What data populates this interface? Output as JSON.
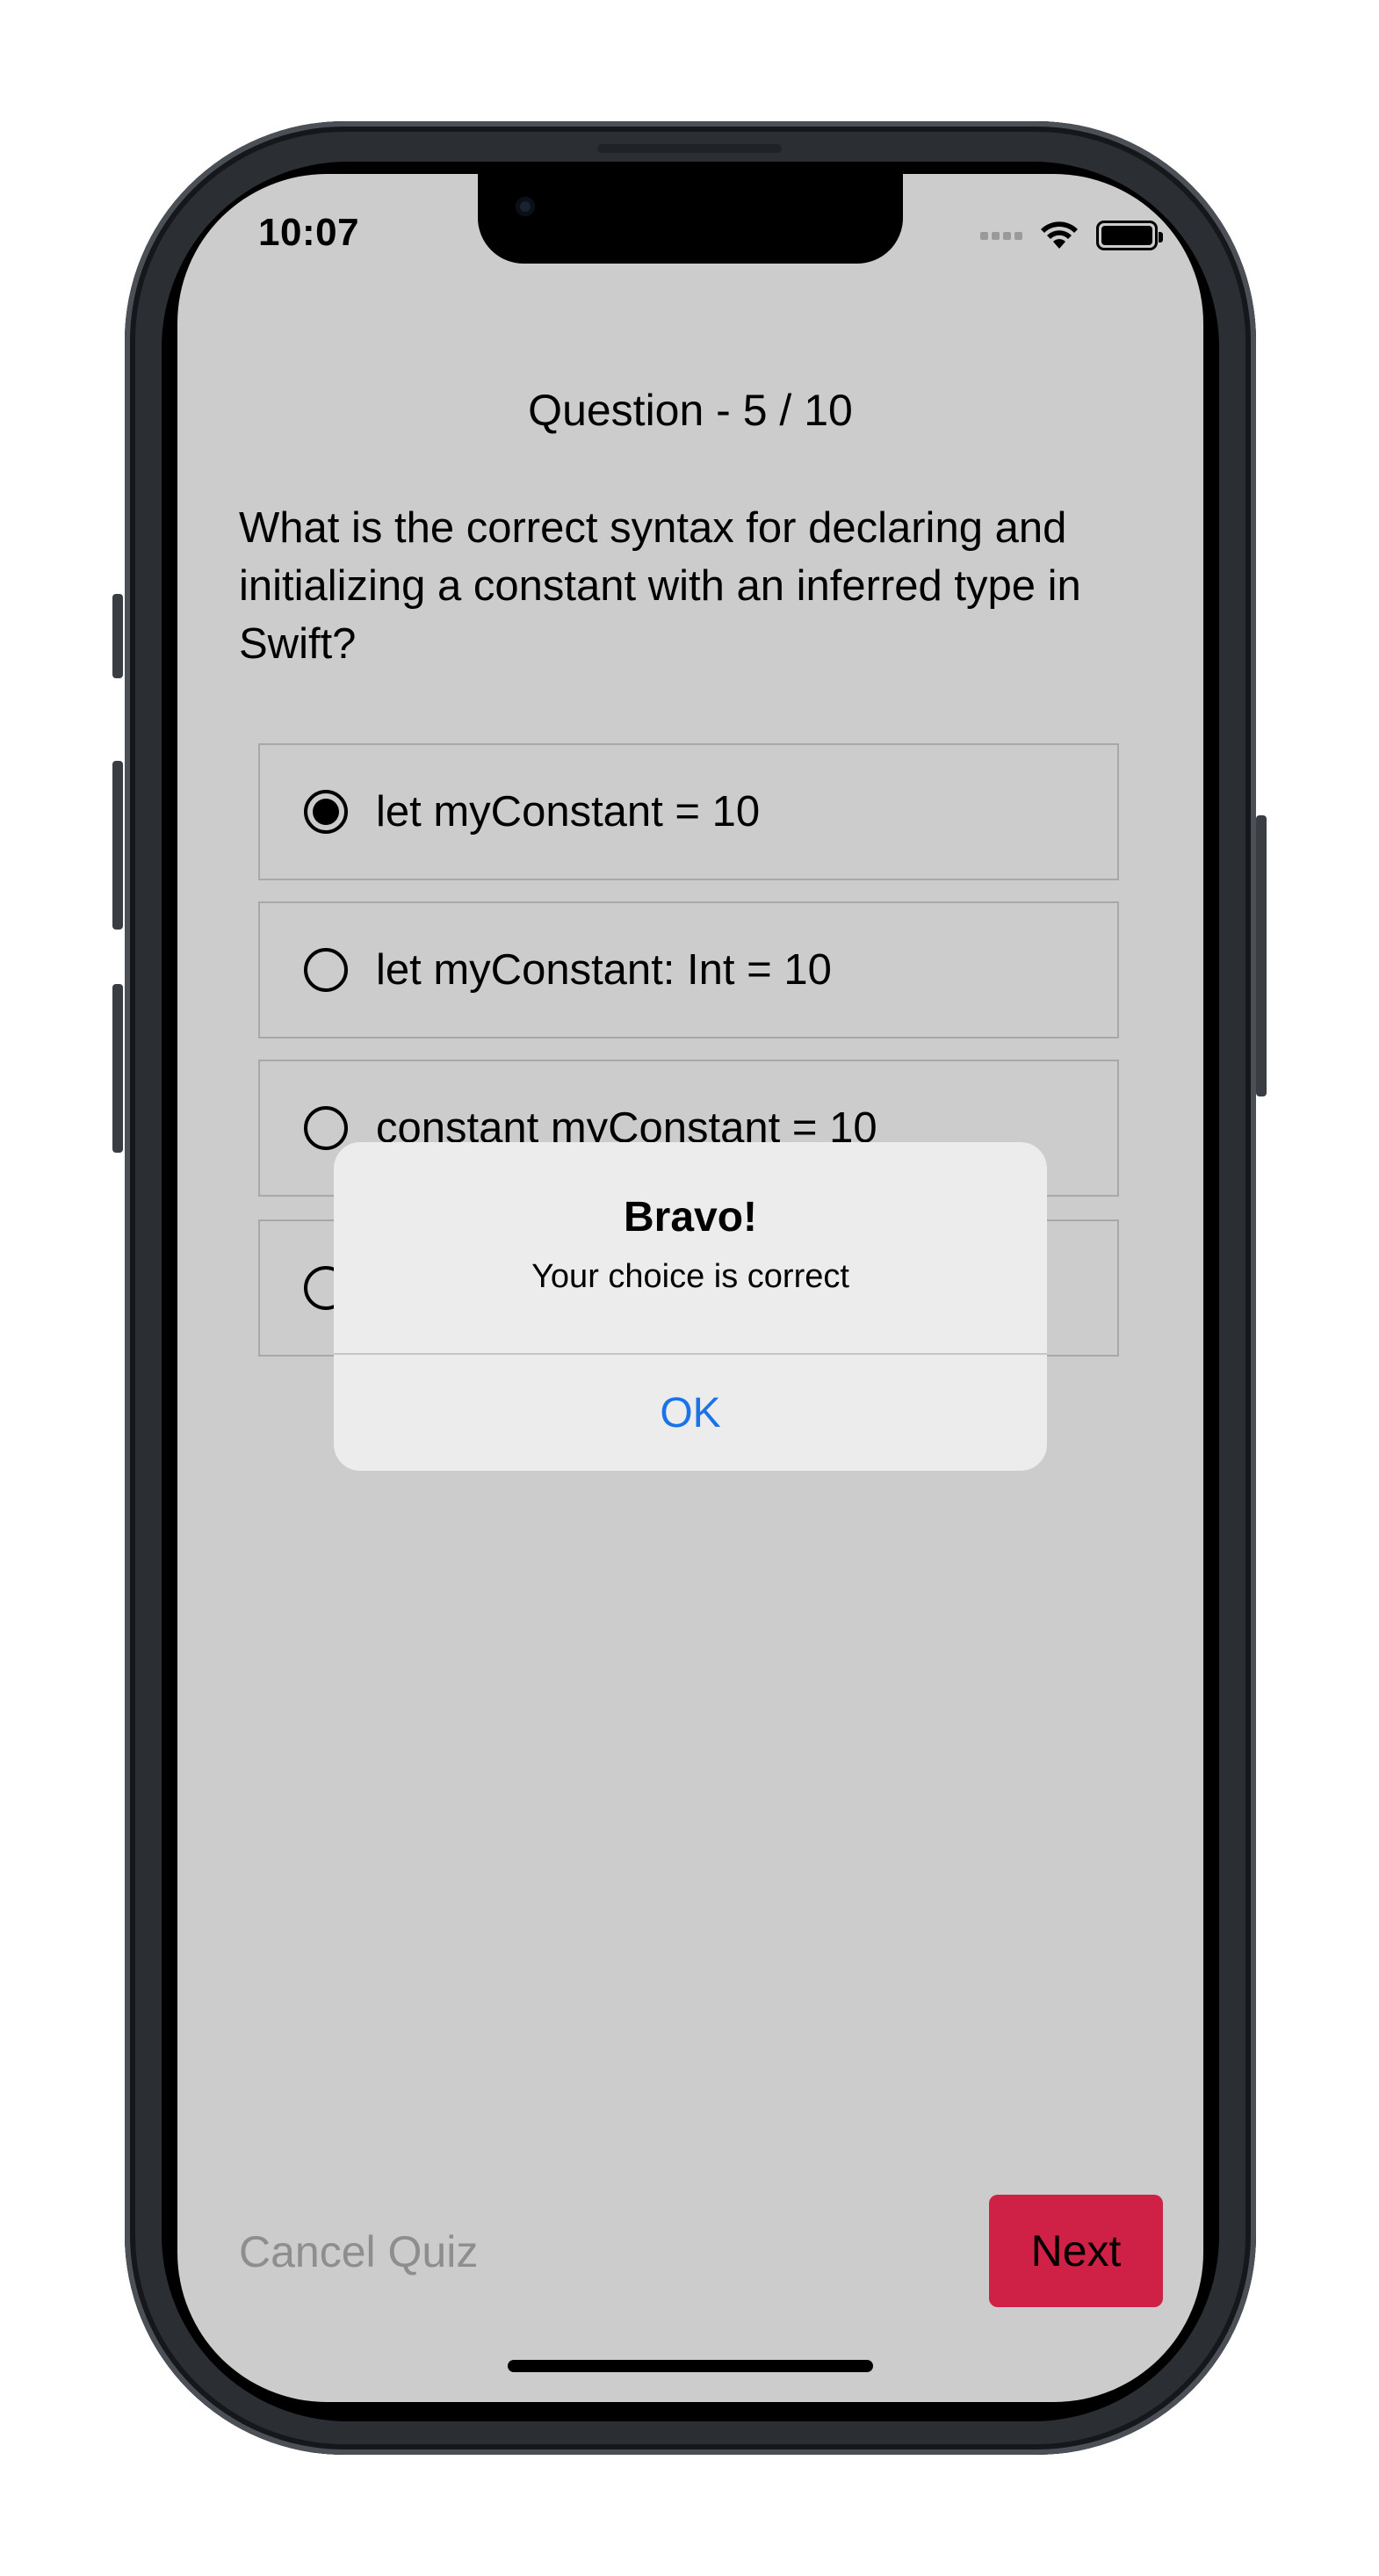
{
  "status_bar": {
    "time": "10:07",
    "icons": [
      "signal-dots-icon",
      "wifi-icon",
      "battery-icon"
    ]
  },
  "quiz": {
    "progress_label": "Question - 5 / 10",
    "question": "What is the correct syntax for declaring and initializing a constant with an inferred type in Swift?",
    "options": [
      {
        "label": "let myConstant = 10",
        "selected": true
      },
      {
        "label": "let myConstant: Int = 10",
        "selected": false
      },
      {
        "label": "constant myConstant = 10",
        "selected": false
      },
      {
        "label": "",
        "selected": false
      }
    ]
  },
  "alert": {
    "title": "Bravo!",
    "message": "Your choice is correct",
    "ok_label": "OK",
    "ok_color": "#1a73e8"
  },
  "footer": {
    "cancel_label": "Cancel Quiz",
    "next_label": "Next",
    "next_color": "#cf2045"
  }
}
